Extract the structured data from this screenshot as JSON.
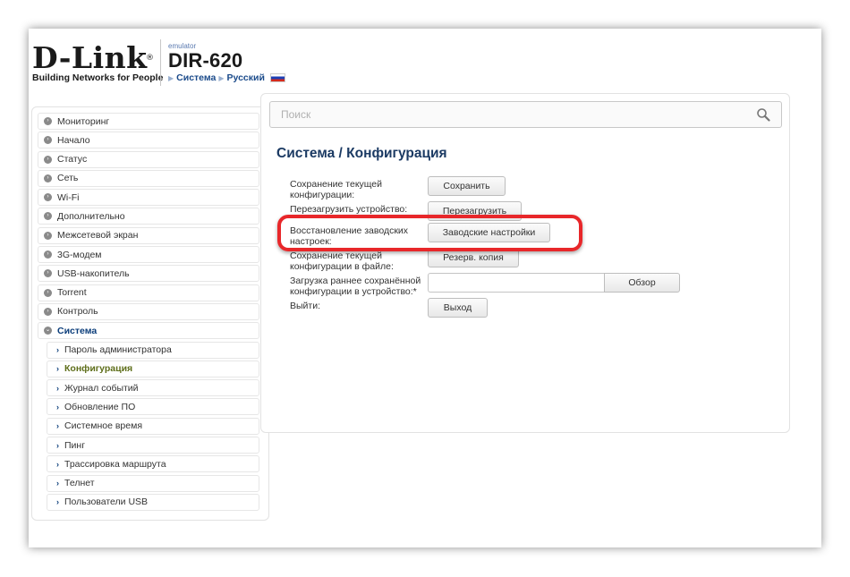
{
  "header": {
    "logo_text": "D-Link",
    "logo_reg": "®",
    "logo_tagline": "Building Networks for People",
    "emulator_label": "emulator",
    "model": "DIR-620",
    "breadcrumb": [
      "Система",
      "Русский"
    ]
  },
  "search": {
    "placeholder": "Поиск",
    "value": ""
  },
  "sidebar": {
    "items": [
      {
        "label": "Мониторинг"
      },
      {
        "label": "Начало"
      },
      {
        "label": "Статус"
      },
      {
        "label": "Сеть"
      },
      {
        "label": "Wi-Fi"
      },
      {
        "label": "Дополнительно"
      },
      {
        "label": "Межсетевой экран"
      },
      {
        "label": "3G-модем"
      },
      {
        "label": "USB-накопитель"
      },
      {
        "label": "Torrent"
      },
      {
        "label": "Контроль"
      },
      {
        "label": "Система"
      }
    ],
    "subitems": [
      {
        "label": "Пароль администратора"
      },
      {
        "label": "Конфигурация"
      },
      {
        "label": "Журнал событий"
      },
      {
        "label": "Обновление ПО"
      },
      {
        "label": "Системное время"
      },
      {
        "label": "Пинг"
      },
      {
        "label": "Трассировка маршрута"
      },
      {
        "label": "Телнет"
      },
      {
        "label": "Пользователи USB"
      }
    ]
  },
  "main": {
    "title": "Система /  Конфигурация",
    "rows": {
      "save_label": "Сохранение текущей конфигурации:",
      "save_button": "Сохранить",
      "reboot_label": "Перезагрузить устройство:",
      "reboot_button": "Перезагрузить",
      "factory_label": "Восстановление заводских настроек:",
      "factory_button": "Заводские настройки",
      "backup_label": "Сохранение текущей конфигурации в файле:",
      "backup_button": "Резерв. копия",
      "restore_label": "Загрузка раннее сохранённой конфигурации в устройство:*",
      "restore_value": "",
      "browse_button": "Обзор",
      "logout_label": "Выйти:",
      "logout_button": "Выход"
    }
  },
  "colors": {
    "title": "#1b3a63",
    "active_nav": "#0b3d7a",
    "current_sub": "#5e6e1a",
    "highlight": "#e8272a"
  }
}
